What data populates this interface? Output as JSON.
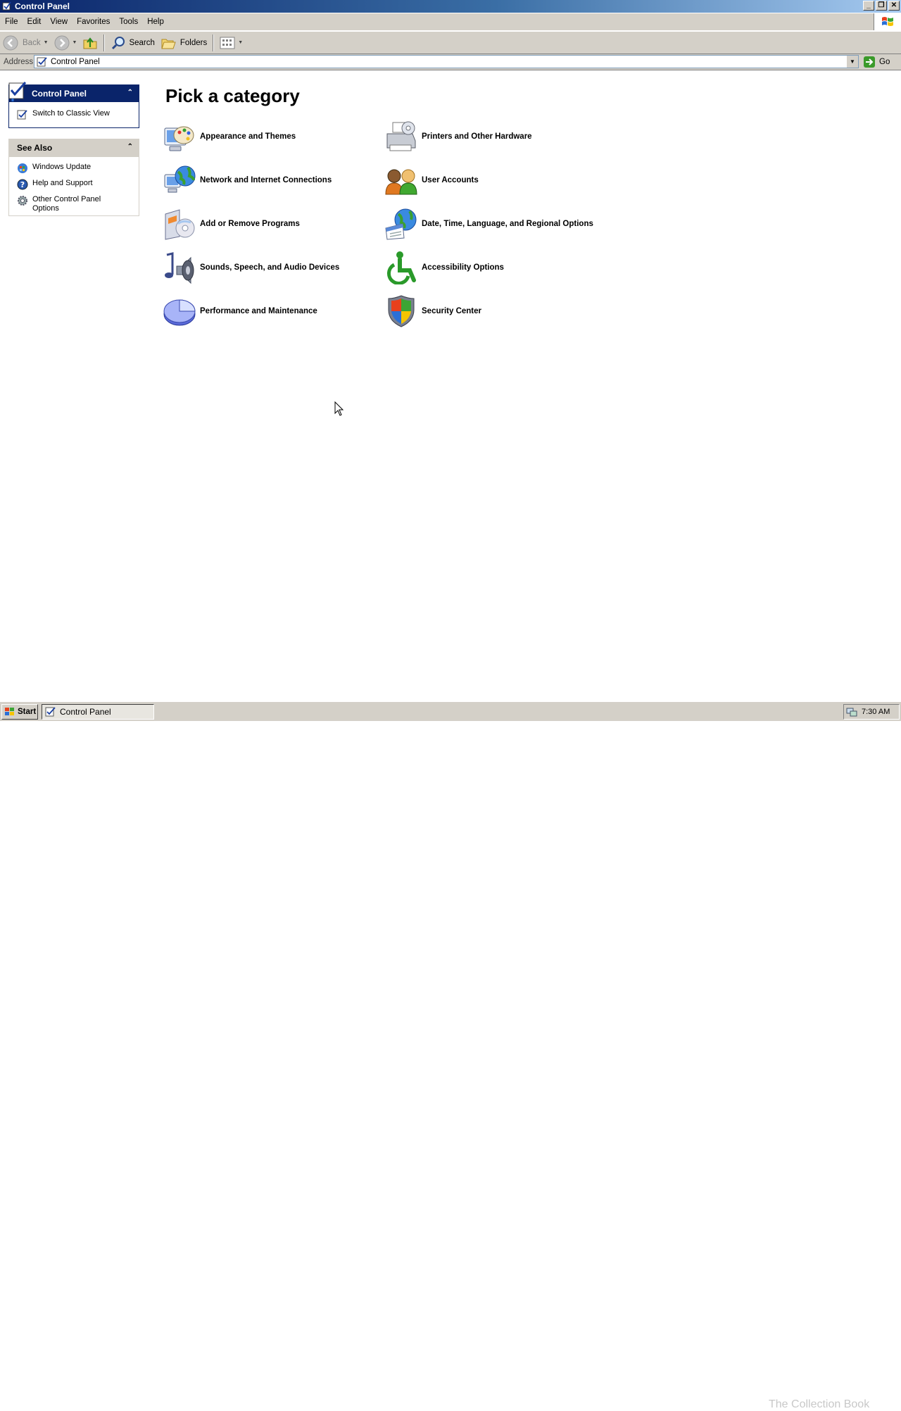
{
  "window": {
    "title": "Control Panel"
  },
  "menu": [
    "File",
    "Edit",
    "View",
    "Favorites",
    "Tools",
    "Help"
  ],
  "toolbar": {
    "back": "Back",
    "search": "Search",
    "folders": "Folders"
  },
  "address": {
    "label": "Address",
    "value": "Control Panel",
    "go": "Go"
  },
  "sidebar": {
    "panel_title": "Control Panel",
    "switch_view": "Switch to Classic View",
    "see_also_title": "See Also",
    "see_also": [
      "Windows Update",
      "Help and Support",
      "Other Control Panel Options"
    ]
  },
  "main": {
    "title": "Pick a category",
    "categories": [
      "Appearance and Themes",
      "Printers and Other Hardware",
      "Network and Internet Connections",
      "User Accounts",
      "Add or Remove Programs",
      "Date, Time, Language, and Regional Options",
      "Sounds, Speech, and Audio Devices",
      "Accessibility Options",
      "Performance and Maintenance",
      "Security Center"
    ]
  },
  "taskbar": {
    "start": "Start",
    "task": "Control Panel",
    "clock": "7:30 AM",
    "watermark": "The Collection Book"
  }
}
